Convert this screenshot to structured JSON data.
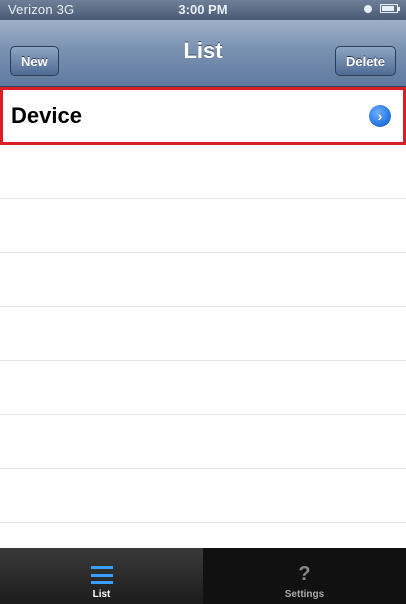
{
  "status_bar": {
    "carrier": "Verizon 3G",
    "time": "3:00 PM"
  },
  "nav": {
    "title": "List",
    "left_button": "New",
    "right_button": "Delete"
  },
  "list": {
    "items": [
      {
        "label": "Device",
        "accessory": "disclosure-icon"
      }
    ]
  },
  "tabs": [
    {
      "label": "List",
      "icon": "list-icon",
      "selected": true
    },
    {
      "label": "Settings",
      "icon": "question-icon",
      "selected": false
    }
  ],
  "colors": {
    "selection_outline": "#d92028",
    "disclosure_blue": "#2b79e2"
  }
}
